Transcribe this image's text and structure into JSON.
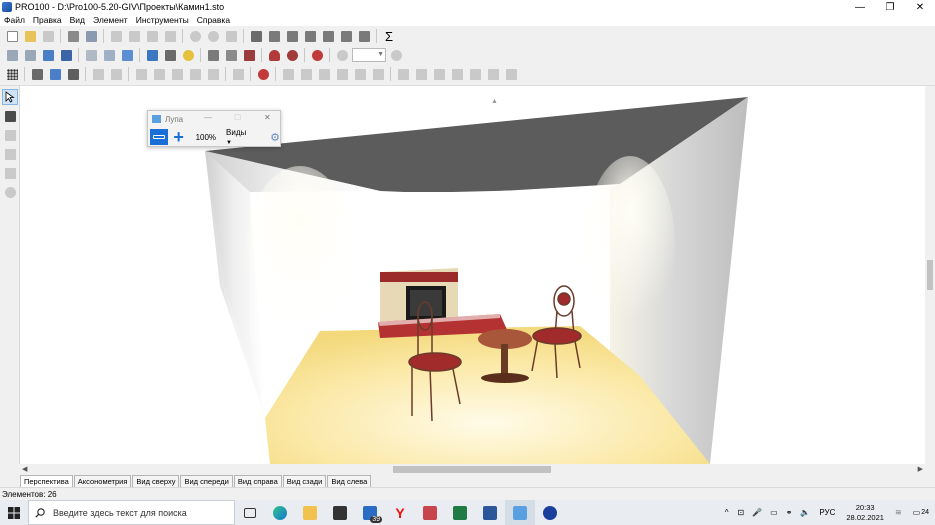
{
  "window": {
    "title": "PRO100 - D:\\Pro100-5.20-GIV\\Проекты\\Камин1.sto"
  },
  "menu": [
    "Файл",
    "Правка",
    "Вид",
    "Элемент",
    "Инструменты",
    "Справка"
  ],
  "magnifier": {
    "title": "Лупа",
    "zoom": "100%",
    "views_label": "Виды"
  },
  "view_tabs": [
    "Перспектива",
    "Аксонометрия",
    "Вид сверху",
    "Вид спереди",
    "Вид справа",
    "Вид сзади",
    "Вид слева"
  ],
  "status": {
    "elements": "Элементов: 26"
  },
  "taskbar": {
    "search_placeholder": "Введите здесь текст для поиска",
    "mail_badge": "39",
    "language": "РУС",
    "time": "20:33",
    "date": "28.02.2021",
    "notifications": "24"
  },
  "colors": {
    "accent": "#1a6fd6",
    "ceiling": "#5c5c5c",
    "floor": "#fbeec0",
    "chair": "#a12a2a"
  }
}
